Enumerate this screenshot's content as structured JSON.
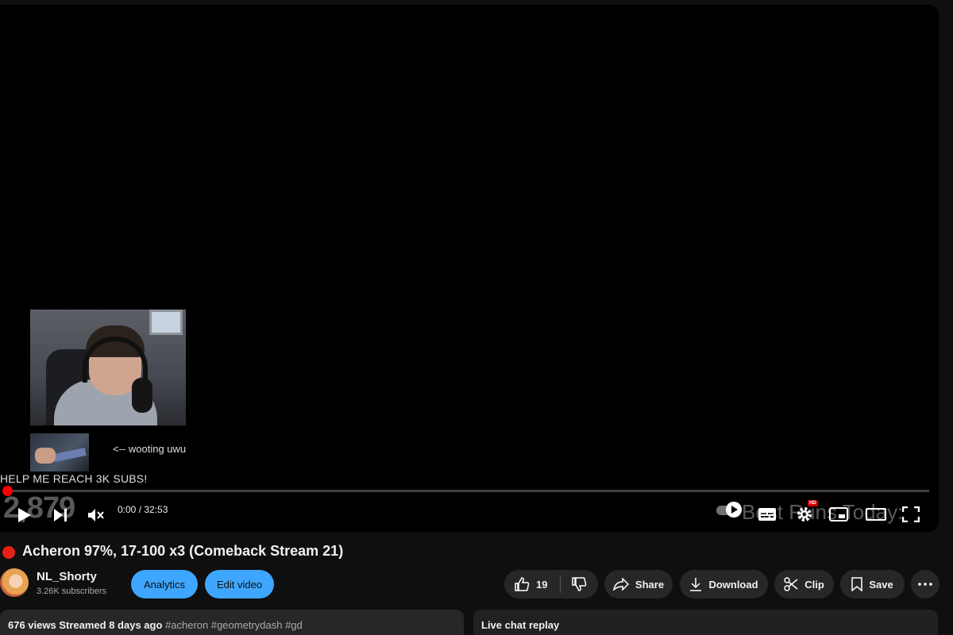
{
  "player": {
    "webcam_caption": "<-- wooting uwu",
    "banner_text": "HELP ME REACH 3K SUBS!",
    "overlay_count": "2,879",
    "overlay_best": "Best Runs Today:",
    "progress_fraction": 0.0,
    "time": "0:00 / 32:53",
    "hd_badge": "HD",
    "icons": [
      "play-icon",
      "next-icon",
      "mute-icon",
      "autoplay-toggle",
      "subtitles-icon",
      "gear-icon",
      "miniplayer-icon",
      "theater-icon",
      "fullscreen-icon"
    ]
  },
  "video": {
    "title": "Acheron 97%, 17-100 x3 (Comeback Stream 21)",
    "live_dot_color": "#e62117"
  },
  "channel": {
    "name": "NL_Shorty",
    "subscribers": "3.26K subscribers"
  },
  "actions": {
    "analytics": "Analytics",
    "edit_video": "Edit video",
    "likes": "19",
    "share": "Share",
    "download": "Download",
    "clip": "Clip",
    "save": "Save"
  },
  "description": {
    "views": "676 views",
    "streamed": "Streamed 8 days ago",
    "tags": "#acheron #geometrydash #gd"
  },
  "chat": {
    "title": "Live chat replay"
  },
  "colors": {
    "accent_blue": "#3ea6ff",
    "progress_red": "#ff0000",
    "button_bg": "#272727"
  }
}
